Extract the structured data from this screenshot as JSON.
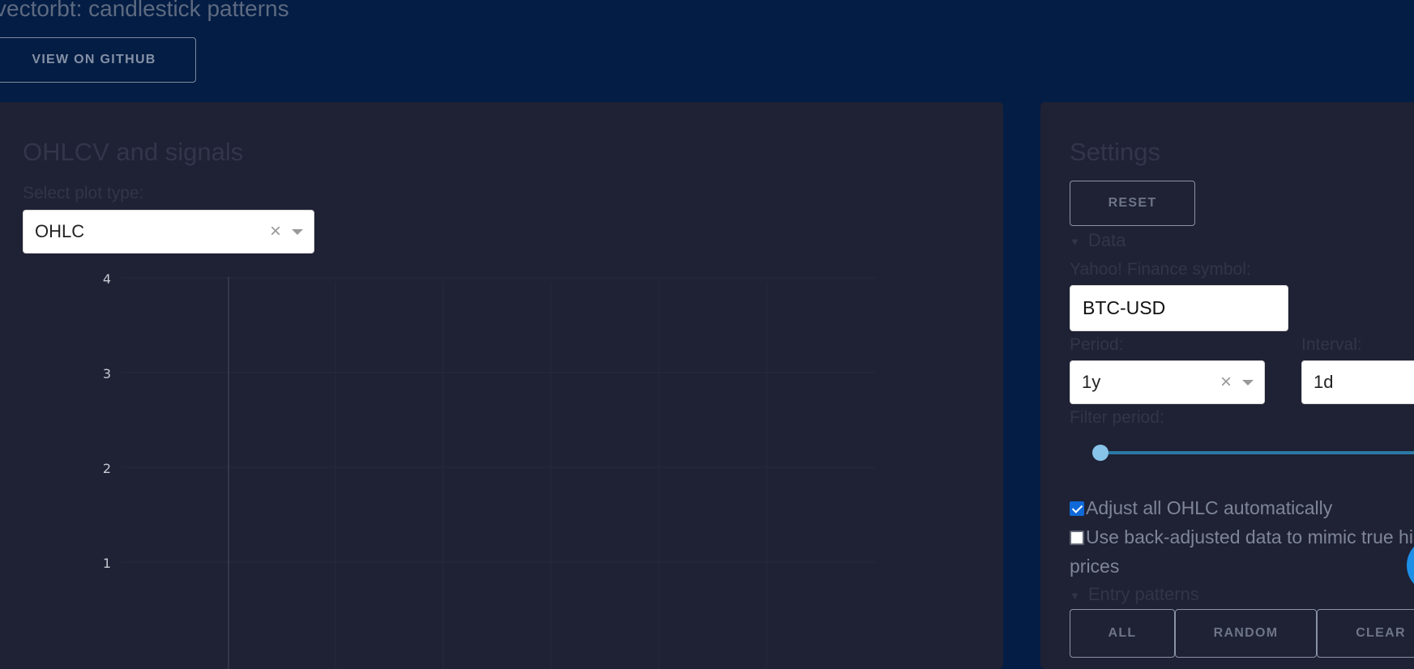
{
  "header": {
    "title": "vectorbt: candlestick patterns",
    "github_button": "VIEW ON GITHUB"
  },
  "left_panel": {
    "title": "OHLCV and signals",
    "plot_type_label": "Select plot type:",
    "plot_type_value": "OHLC",
    "chart": {
      "y_ticks": [
        "4",
        "3",
        "2",
        "1"
      ]
    }
  },
  "right_panel": {
    "title": "Settings",
    "reset_button": "RESET",
    "data_section": "Data",
    "symbol_label": "Yahoo! Finance symbol:",
    "symbol_value": "BTC-USD",
    "period_label": "Period:",
    "period_value": "1y",
    "interval_label": "Interval:",
    "interval_value": "1d",
    "filter_period_label": "Filter period:",
    "adjust_ohlc_label": "Adjust all OHLC automatically",
    "adjust_ohlc_checked": true,
    "back_adjusted_label": "Use back-adjusted data to mimic true historical prices",
    "back_adjusted_checked": false,
    "entry_patterns_section": "Entry patterns",
    "buttons": {
      "all": "ALL",
      "random": "RANDOM",
      "clear": "CLEAR"
    }
  },
  "colors": {
    "page_bg": "#041d44",
    "panel_bg": "#1f2134",
    "slider": "#2b7aa4",
    "accent": "#1d8fe6"
  },
  "icons": [
    "clear-icon",
    "chevron-down-icon",
    "triangle-down-icon",
    "checkbox-icon"
  ]
}
